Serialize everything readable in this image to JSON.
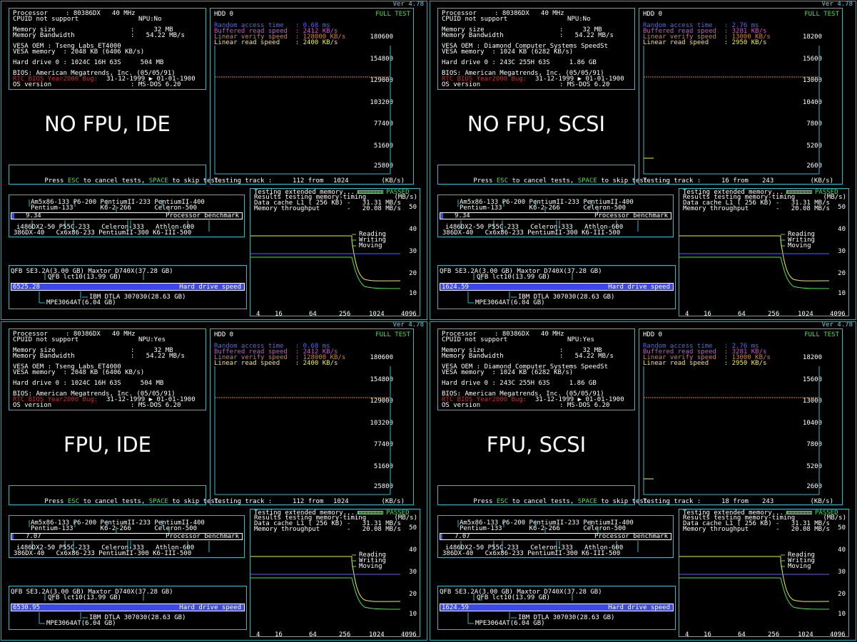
{
  "version": "Ver 4.78",
  "common": {
    "processor_label": "Processor",
    "processor_value": ": 80386DX   40 MHz",
    "cpuid_label": "CPUID not support",
    "memsize_label": "Memory size",
    "memsize_value": ":     32 MB",
    "membw_label": "Memory Bandwidth",
    "membw_value": ":   54.22 MB/s",
    "bios": "BIOS: American Megatrends, Inc. (05/05/91)",
    "y2k_label": "RTC BIOS Year2000 Bug:",
    "y2k_value": "31-12-1999 ▶ 01-01-1900",
    "os_label": "OS version",
    "os_value": ": MS-DOS 6.20",
    "press": "Press",
    "esc": "ESC",
    "cancel": "to cancel tests,",
    "space": "SPACE",
    "skip": "to skip test.",
    "hdd_title": "HDD 0",
    "full_test": "FULL TEST",
    "random_access": "Random access time   :",
    "buffered_read": "Buffered read speed  :",
    "linear_verify": "Linear verify speed  :",
    "linear_read": "Linear read speed    :",
    "testing_track": "Testing track :",
    "track_from": "from",
    "kbs": "(KB/s)",
    "cpu_ref": {
      "r1": "Am5x86-133 P6-200 PentiumII-233 PentiumII-400",
      "r2": "Pentium-133       K6-2-266      Celeron-500",
      "r3": "i486DX2-50 P55C-233   Celeron-333   Athlon-600",
      "r4": "386DX-40   Cx6x86-233 PentiumII-300 K6-III-500",
      "label": "Processor benchmark"
    },
    "hdd_ref": {
      "r1": "QFB SE3.2A(3.00 GB) Maxtor D740X(37.28 GB)",
      "r2": "QFB lct10(13.99 GB)",
      "r3": "IBM DTLA 307030(28.63 GB)",
      "r4": "MPE3064AT(6.04 GB)",
      "label": "Hard drive speed"
    },
    "mem": {
      "l1": "Testing extended memory...",
      "passed": "PASSED",
      "l2": "Results testing memory-timing",
      "mbs": "(MB/s)",
      "l3": "Data cache L1 ( 256 KB) -   31.31 MB/s",
      "l4": "Memory throughput       -   20.08 MB/s",
      "reading": "Reading",
      "writing": "Writing",
      "moving": "Moving",
      "y": [
        "50",
        "40",
        "30",
        "20",
        "10"
      ],
      "x": [
        "4",
        "16",
        "64",
        "256",
        "1024",
        "4096"
      ]
    },
    "colors": {
      "frame": "#34b9c4",
      "bar": "#3b49e8",
      "read": "#f2ee40",
      "write": "#4ee24e",
      "move": "#5a63ff"
    }
  },
  "quads": [
    {
      "label": "NO FPU, IDE",
      "fpu": "NPU:No",
      "vesa_oem": "VESA OEM : Tseng Labs ET4000",
      "vesa_mem": "VESA memory  : 2048 KB (6406 KB/s)",
      "hdd0": "Hard drive 0 : 1024C 16H 63S     504 MB",
      "rnd": "0.68 ms",
      "buf": "2412 KB/s",
      "ver": "128000 KB/s",
      "lin": "2400 KB/s",
      "yticks": [
        "180600",
        "154800",
        "129000",
        "103200",
        "77400",
        "51600",
        "25800"
      ],
      "track": "112",
      "track_of": "1024",
      "cpu_score": "9.34",
      "hdd_score": "6525.28"
    },
    {
      "label": "NO FPU, SCSI",
      "fpu": "NPU:No",
      "vesa_oem": "VESA OEM : Diamond Computer Systems SpeedSt",
      "vesa_mem": "VESA memory  : 1024 KB (6282 KB/s)",
      "hdd0": "Hard drive 0 : 243C 255H 63S     1.86 GB",
      "rnd": "2.76 ms",
      "buf": "3281 KB/s",
      "ver": "13000 KB/s",
      "lin": "2950 KB/s",
      "yticks": [
        "18200",
        "15600",
        "13000",
        "10400",
        "7800",
        "5200",
        "2600"
      ],
      "track": "16",
      "track_of": "243",
      "cpu_score": "9.34",
      "hdd_score": "1624.59"
    },
    {
      "label": "FPU, IDE",
      "fpu": "NPU:Yes",
      "vesa_oem": "VESA OEM : Tseng Labs ET4000",
      "vesa_mem": "VESA memory  : 2048 KB (6406 KB/s)",
      "hdd0": "Hard drive 0 : 1024C 16H 63S     504 MB",
      "rnd": "0.68 ms",
      "buf": "2412 KB/s",
      "ver": "128000 KB/s",
      "lin": "2400 KB/s",
      "yticks": [
        "180600",
        "154800",
        "129000",
        "103200",
        "77400",
        "51600",
        "25800"
      ],
      "track": "112",
      "track_of": "1024",
      "cpu_score": "7.07",
      "hdd_score": "6530.95"
    },
    {
      "label": "FPU, SCSI",
      "fpu": "NPU:Yes",
      "vesa_oem": "VESA OEM : Diamond Computer Systems SpeedSt",
      "vesa_mem": "VESA memory  : 1024 KB (6282 KB/s)",
      "hdd0": "Hard drive 0 : 243C 255H 63S     1.86 GB",
      "rnd": "2.76 ms",
      "buf": "3281 KB/s",
      "ver": "13000 KB/s",
      "lin": "2950 KB/s",
      "yticks": [
        "18200",
        "15600",
        "13000",
        "10400",
        "7800",
        "5200",
        "2600"
      ],
      "track": "18",
      "track_of": "243",
      "cpu_score": "7.07",
      "hdd_score": "1624.59"
    }
  ]
}
